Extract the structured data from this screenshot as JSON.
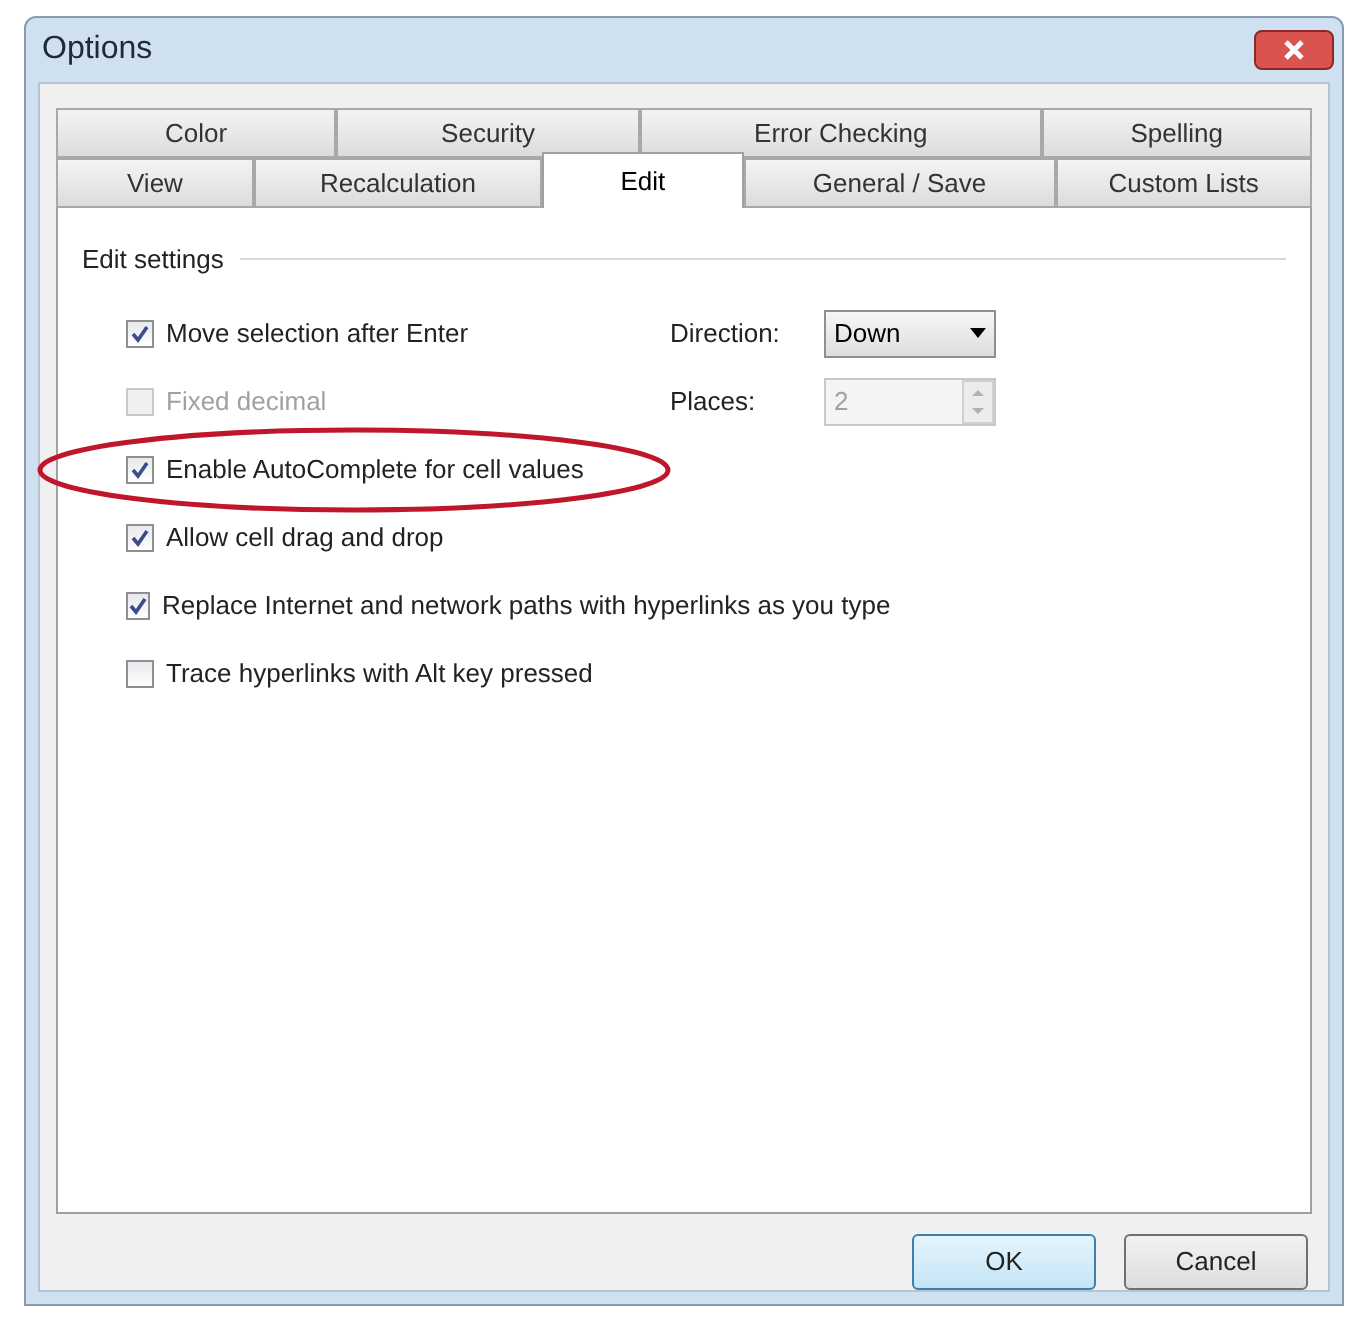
{
  "window": {
    "title": "Options"
  },
  "tab_rows": [
    [
      {
        "label": "Color",
        "selected": false
      },
      {
        "label": "Security",
        "selected": false
      },
      {
        "label": "Error Checking",
        "selected": false
      },
      {
        "label": "Spelling",
        "selected": false
      }
    ],
    [
      {
        "label": "View",
        "selected": false
      },
      {
        "label": "Recalculation",
        "selected": false
      },
      {
        "label": "Edit",
        "selected": true
      },
      {
        "label": "General / Save",
        "selected": false
      },
      {
        "label": "Custom Lists",
        "selected": false
      }
    ]
  ],
  "group": {
    "label": "Edit settings"
  },
  "options": [
    {
      "label": "Move selection after Enter",
      "checked": true,
      "disabled": false,
      "circled": false,
      "side": {
        "label": "Direction:",
        "kind": "dropdown",
        "value": "Down",
        "disabled": false
      }
    },
    {
      "label": "Fixed decimal",
      "checked": false,
      "disabled": true,
      "circled": false,
      "side": {
        "label": "Places:",
        "kind": "spinner",
        "value": "2",
        "disabled": true
      }
    },
    {
      "label": "Enable AutoComplete for cell values",
      "checked": true,
      "disabled": false,
      "circled": true
    },
    {
      "label": "Allow cell drag and drop",
      "checked": true,
      "disabled": false,
      "circled": false
    },
    {
      "label": "Replace Internet and network paths with hyperlinks as you type",
      "checked": true,
      "disabled": false,
      "circled": false
    },
    {
      "label": "Trace hyperlinks with Alt key pressed",
      "checked": false,
      "disabled": false,
      "circled": false
    }
  ],
  "buttons": [
    {
      "label": "OK",
      "default": true
    },
    {
      "label": "Cancel",
      "default": false
    }
  ]
}
